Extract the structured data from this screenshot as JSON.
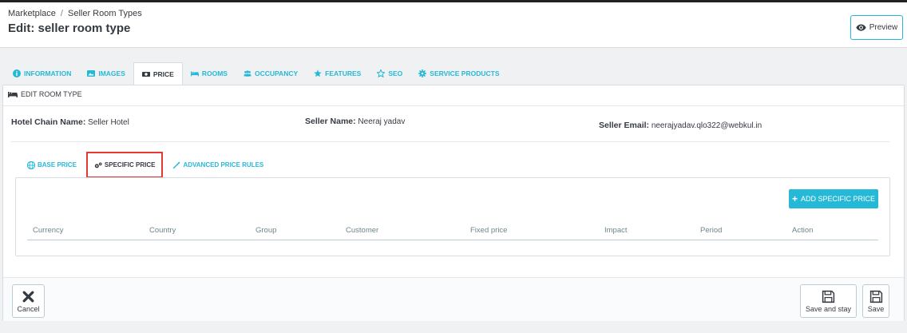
{
  "breadcrumb": {
    "parent": "Marketplace",
    "separator": "/",
    "current": "Seller Room Types"
  },
  "page_title": "Edit: seller room type",
  "toolbar": {
    "preview_label": "Preview"
  },
  "tabs": [
    {
      "label": "INFORMATION",
      "icon": "info-circle-icon"
    },
    {
      "label": "IMAGES",
      "icon": "picture-icon"
    },
    {
      "label": "PRICE",
      "icon": "money-icon"
    },
    {
      "label": "ROOMS",
      "icon": "bed-icon"
    },
    {
      "label": "OCCUPANCY",
      "icon": "users-icon"
    },
    {
      "label": "FEATURES",
      "icon": "star-icon"
    },
    {
      "label": "SEO",
      "icon": "star-outline-icon"
    },
    {
      "label": "SERVICE PRODUCTS",
      "icon": "gear-icon"
    }
  ],
  "active_tab": "PRICE",
  "panel": {
    "heading": "EDIT ROOM TYPE"
  },
  "info": {
    "hotel_chain_label": "Hotel Chain Name:",
    "hotel_chain_value": "Seller Hotel",
    "seller_name_label": "Seller Name:",
    "seller_name_value": "Neeraj yadav",
    "seller_email_label": "Seller Email:",
    "seller_email_value": "neerajyadav.qlo322@webkul.in"
  },
  "subtabs": [
    {
      "label": "BASE PRICE",
      "icon": "globe-icon"
    },
    {
      "label": "SPECIFIC PRICE",
      "icon": "cogs-icon"
    },
    {
      "label": "ADVANCED PRICE RULES",
      "icon": "magic-wand-icon"
    }
  ],
  "add_specific_price_label": "ADD SPECIFIC PRICE",
  "table": {
    "columns": [
      "Currency",
      "Country",
      "Group",
      "Customer",
      "Fixed price",
      "Impact",
      "Period",
      "Action"
    ]
  },
  "footer": {
    "cancel_label": "Cancel",
    "save_and_stay_label": "Save and stay",
    "save_label": "Save"
  },
  "colors": {
    "accent": "#25b9d7",
    "highlight_border": "#e53935",
    "text": "#363a41"
  }
}
